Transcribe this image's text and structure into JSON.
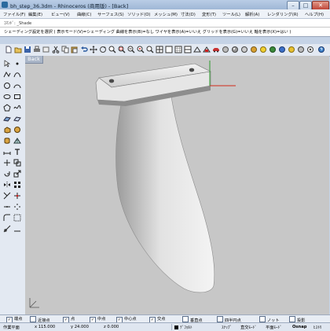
{
  "window": {
    "title": "bh_step_36.3dm - Rhinoceros (商用版) - [Back]",
    "min_glyph": "–",
    "max_glyph": "□",
    "close_glyph": "✕"
  },
  "menu": [
    "ファイル(F)",
    "編集(E)",
    "ビュー(V)",
    "曲線(C)",
    "サーフェス(S)",
    "ソリッド(O)",
    "メッシュ(M)",
    "寸法(D)",
    "変形(T)",
    "ツール(L)",
    "解析(A)",
    "レンダリング(R)",
    "ヘルプ(H)"
  ],
  "command_history": "ｺﾏﾝﾄﾞ: _Shade",
  "command_prompt": "シェーディング設定を選択 ( 表示モード(V)=シェーディング  曲線を表示(B)=なし  ワイヤを表示(A)=いいえ  グリッドを表示(G)=いいえ  軸を表示(X)=はい )",
  "viewport": {
    "tab_label": "Back"
  },
  "colors": {
    "axis_x": "#d12a1a",
    "axis_y": "#2b9a2b",
    "viewport_bg": "#c7c7c7"
  },
  "osnap": [
    {
      "label": "端点",
      "checked": true
    },
    {
      "label": "近接点",
      "checked": false
    },
    {
      "label": "点",
      "checked": true
    },
    {
      "label": "中点",
      "checked": true
    },
    {
      "label": "中心点",
      "checked": true
    },
    {
      "label": "交点",
      "checked": true
    },
    {
      "label": "垂直点",
      "checked": false
    },
    {
      "label": "四半円点",
      "checked": false
    },
    {
      "label": "ノット",
      "checked": false
    },
    {
      "label": "投影",
      "checked": false
    }
  ],
  "status": {
    "plane": "作業平面",
    "x": "x 115.000",
    "y": "y 24.000",
    "z": "z 0.000",
    "layer": "ﾃﾞﾌｫﾙﾄ",
    "snap": "ｽﾅｯﾌﾟ",
    "ortho": "直交ﾓｰﾄﾞ",
    "planar": "平面ﾓｰﾄﾞ",
    "osnap": "Osnap",
    "history": "ﾋｽﾄﾘ"
  }
}
